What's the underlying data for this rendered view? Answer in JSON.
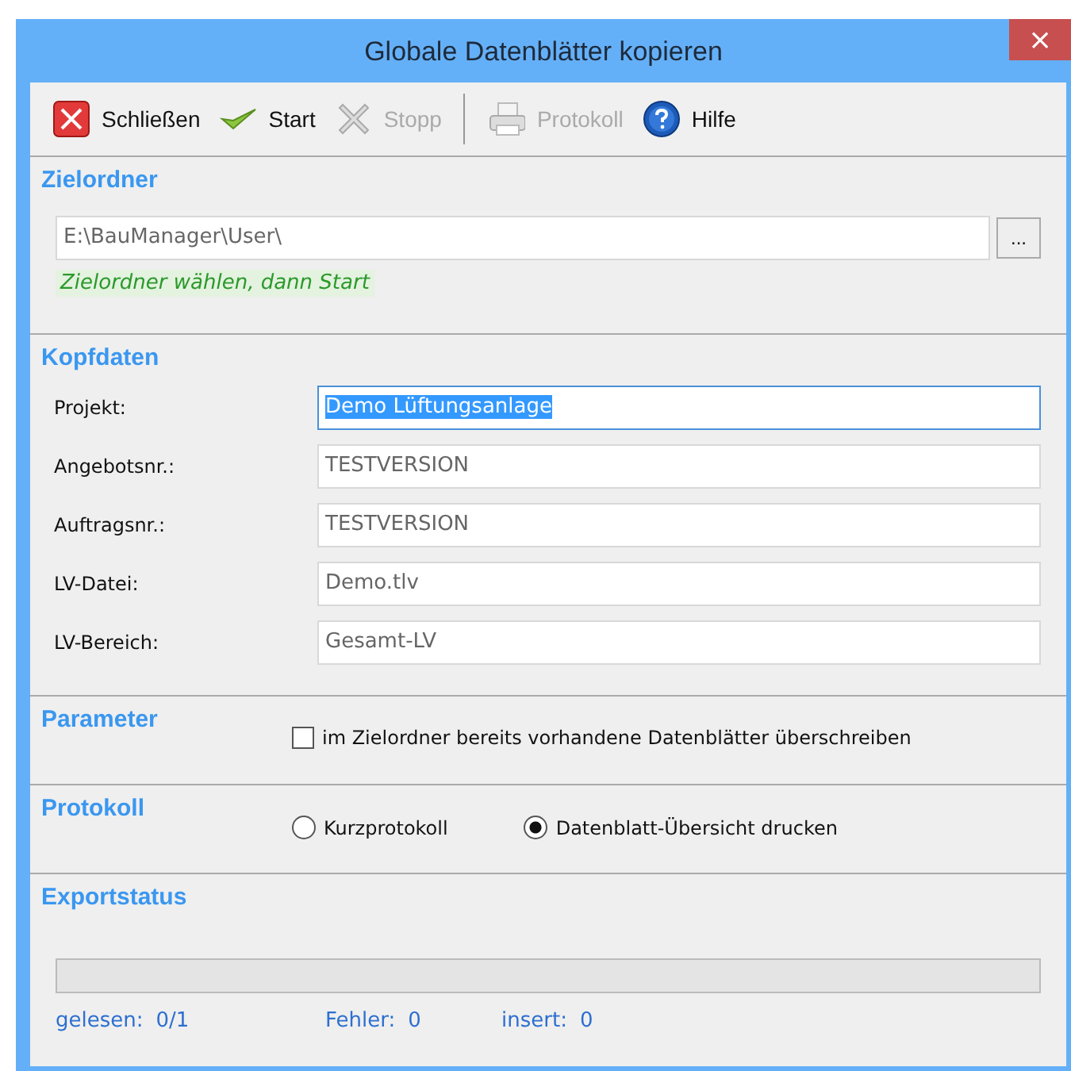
{
  "window": {
    "title": "Globale Datenblätter kopieren",
    "close": "×"
  },
  "toolbar": [
    {
      "kind": "close",
      "label": "Schließen",
      "disabled": false
    },
    {
      "kind": "check",
      "label": "Start",
      "disabled": false
    },
    {
      "kind": "cross",
      "label": "Stopp",
      "disabled": true
    },
    {
      "kind": "separator"
    },
    {
      "kind": "printer",
      "label": "Protokoll",
      "disabled": true
    },
    {
      "kind": "help",
      "label": "Hilfe",
      "disabled": false
    }
  ],
  "sections": [
    {
      "kind": "folder",
      "title": "Zielordner",
      "path": "E:\\BauManager\\User\\",
      "browse": "...",
      "hint": "Zielordner wählen, dann Start"
    },
    {
      "kind": "fields",
      "title": "Kopfdaten",
      "fields": [
        {
          "label": "Projekt:",
          "value": "Demo Lüftungsanlage",
          "focused": true
        },
        {
          "label": "Angebotsnr.:",
          "value": "TESTVERSION",
          "focused": false
        },
        {
          "label": "Auftragsnr.:",
          "value": "TESTVERSION",
          "focused": false
        },
        {
          "label": "LV-Datei:",
          "value": "Demo.tlv",
          "focused": false
        },
        {
          "label": "LV-Bereich:",
          "value": "Gesamt-LV",
          "focused": false
        }
      ]
    },
    {
      "kind": "checkbox",
      "title": "Parameter",
      "label": "im Zielordner bereits vorhandene Datenblätter überschreiben",
      "checked": false
    },
    {
      "kind": "radios",
      "title": "Protokoll",
      "options": [
        {
          "label": "Kurzprotokoll",
          "selected": false
        },
        {
          "label": "Datenblatt-Übersicht drucken",
          "selected": true
        }
      ]
    },
    {
      "kind": "status",
      "title": "Exportstatus",
      "level": 0,
      "stats": [
        {
          "label": "gelesen:",
          "value": "0/1"
        },
        {
          "label": "Fehler:",
          "value": "0"
        },
        {
          "label": "insert:",
          "value": "0"
        }
      ]
    }
  ]
}
